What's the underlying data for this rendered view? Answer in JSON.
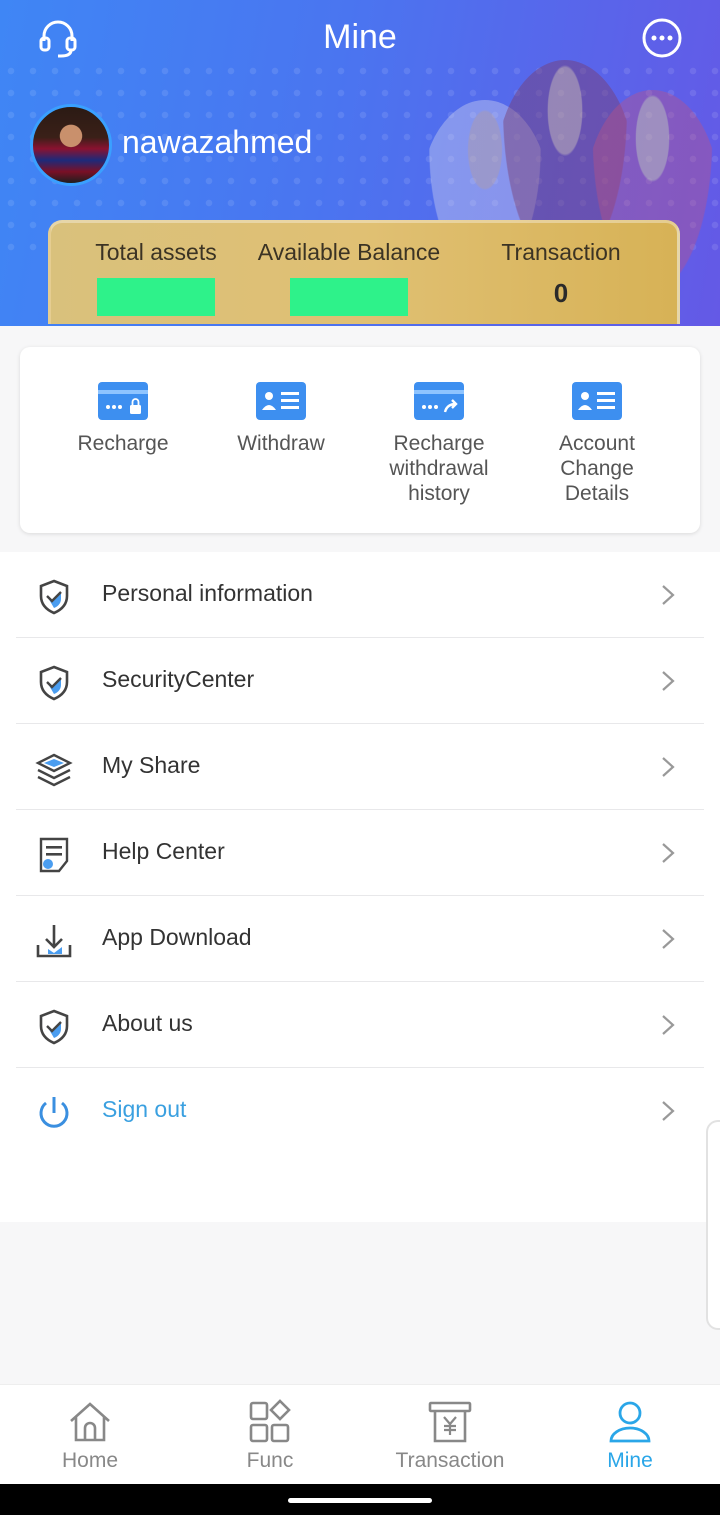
{
  "header": {
    "title": "Mine",
    "username": "nawazahmed",
    "support_icon": "headset-icon",
    "more_icon": "more-horizontal-icon"
  },
  "assets": {
    "total_label": "Total assets",
    "available_label": "Available Balance",
    "transaction_label": "Transaction",
    "transaction_value": "0",
    "mask_color": "#2ef28a"
  },
  "actions": [
    {
      "label": "Recharge",
      "icon": "card-lock-icon"
    },
    {
      "label": "Withdraw",
      "icon": "id-card-icon"
    },
    {
      "label": "Recharge withdrawal history",
      "icon": "card-arrow-icon"
    },
    {
      "label": "Account Change Details",
      "icon": "id-card-icon"
    }
  ],
  "menu": [
    {
      "label": "Personal information",
      "icon": "shield-check-icon"
    },
    {
      "label": "SecurityCenter",
      "icon": "shield-check-icon"
    },
    {
      "label": "My Share",
      "icon": "layers-icon"
    },
    {
      "label": "Help Center",
      "icon": "document-icon"
    },
    {
      "label": "App Download",
      "icon": "download-icon"
    },
    {
      "label": "About us",
      "icon": "shield-check-icon"
    },
    {
      "label": "Sign out",
      "icon": "power-icon"
    }
  ],
  "nav": {
    "home": "Home",
    "func": "Func",
    "transaction": "Transaction",
    "mine": "Mine",
    "active": "Mine"
  },
  "colors": {
    "accent": "#2aa6e8",
    "header_start": "#3f86f5",
    "header_end": "#6459e6",
    "gold": "#e0c073"
  }
}
